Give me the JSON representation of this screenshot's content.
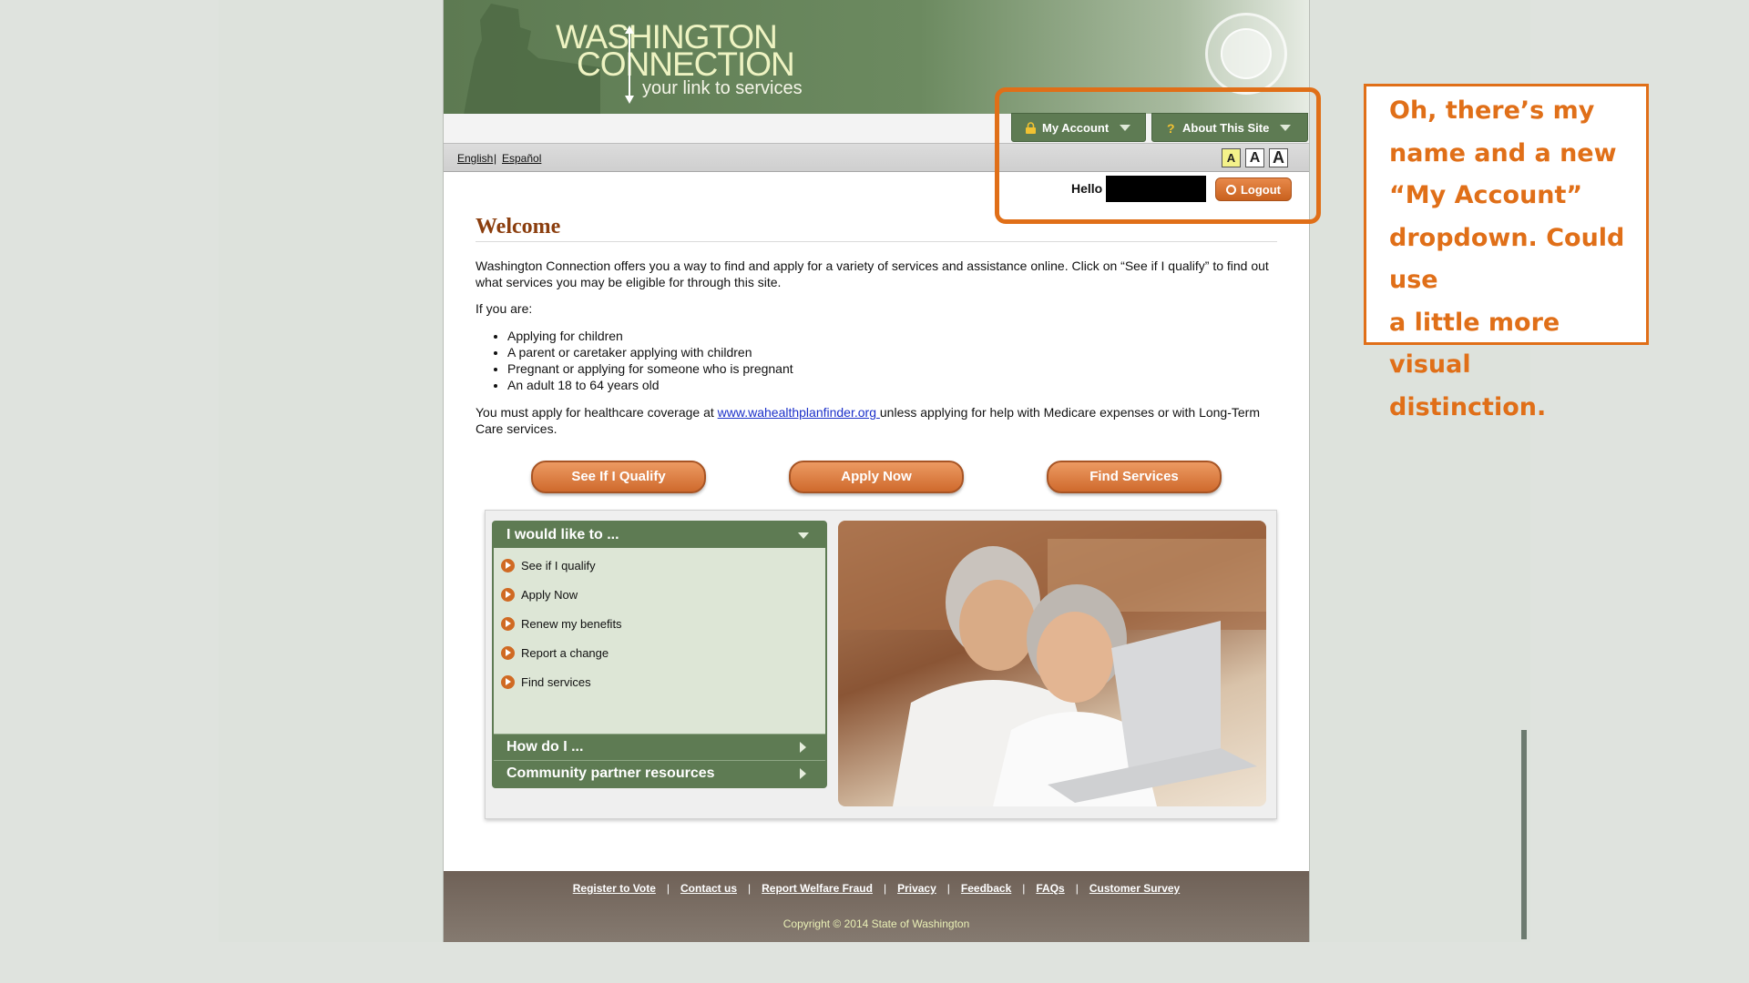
{
  "header": {
    "logo_line1": "WASHINGTON",
    "logo_line2": "CONNECTION",
    "logo_tagline": "your link to services",
    "nav": [
      {
        "label": "My Account",
        "icon": "lock-icon"
      },
      {
        "label": "About This Site",
        "icon": "question-icon"
      }
    ]
  },
  "lang": {
    "english": "English",
    "separator": "|",
    "spanish": "Español"
  },
  "font_sizes": [
    "A",
    "A",
    "A"
  ],
  "user": {
    "hello": "Hello",
    "logout": "Logout"
  },
  "welcome": {
    "title": "Welcome",
    "intro": "Washington Connection offers you a way to find and apply for a variety of services and assistance online. Click on “See if I qualify” to find out what services you may be eligible for through this site.",
    "if_you_are": "If you are:",
    "bullets": [
      "Applying for children",
      "A parent or caretaker applying with children",
      "Pregnant or applying for someone who is pregnant",
      "An adult 18 to 64 years old"
    ],
    "healthcare_prefix": "You must apply for healthcare coverage at ",
    "healthcare_link": "www.wahealthplanfinder.org ",
    "healthcare_suffix": "unless applying for help with Medicare expenses or with Long-Term Care services."
  },
  "cta": [
    "See If I Qualify",
    "Apply Now",
    "Find Services"
  ],
  "menu": {
    "title": "I would like to ...",
    "items": [
      "See if I qualify",
      "Apply Now",
      "Renew my benefits",
      "Report a change",
      "Find services"
    ],
    "how_do_i": "How do I ...",
    "community": "Community partner resources"
  },
  "footer": {
    "links": [
      "Register to Vote",
      "Contact us",
      "Report Welfare Fraud",
      "Privacy",
      "Feedback",
      "FAQs",
      "Customer Survey"
    ],
    "separator": "|",
    "copyright": "Copyright © 2014 State of Washington"
  },
  "annotation": {
    "lines": [
      "Oh, there’s my",
      "name and a new",
      "“My Account”",
      "dropdown. Could use",
      "a little more visual",
      "distinction."
    ]
  },
  "colors": {
    "brand_green": "#5e7b53",
    "accent_orange": "#d06a23",
    "annotation_orange": "#e06f18"
  }
}
